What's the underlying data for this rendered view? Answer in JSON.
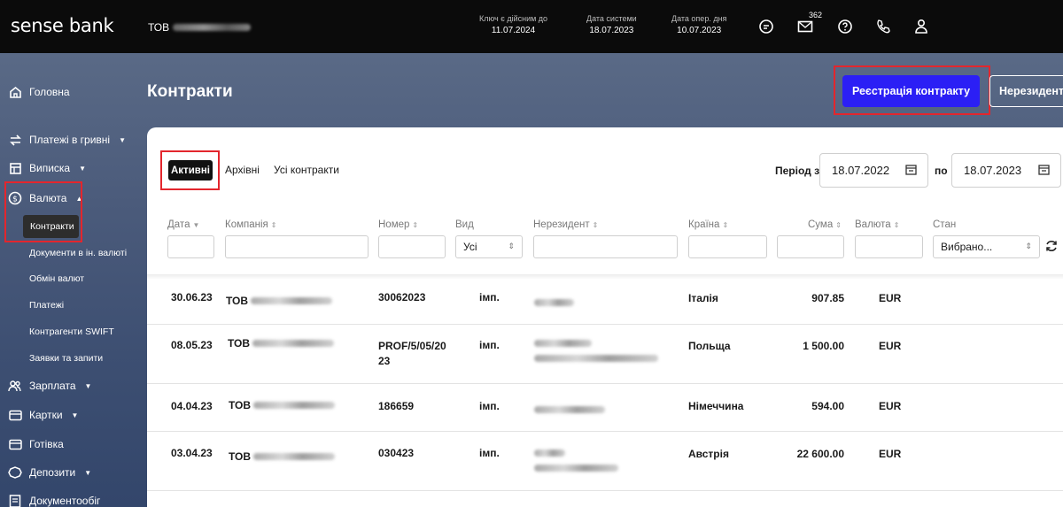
{
  "app": {
    "logo": "sense bank",
    "company_prefix": "ТОВ"
  },
  "topbar": {
    "key_label": "Ключ є дійсним до",
    "key_value": "11.07.2024",
    "sys_date_label": "Дата системи",
    "sys_date_value": "18.07.2023",
    "op_day_label": "Дата опер. дня",
    "op_day_value": "10.07.2023",
    "mail_count": "362",
    "icons": [
      "chat-icon",
      "mail-icon",
      "help-icon",
      "phone-icon",
      "user-icon"
    ]
  },
  "sidebar": {
    "items": [
      {
        "label": "Головна",
        "icon": "home-icon"
      },
      {
        "label": "Платежі в гривні",
        "icon": "transfer-icon",
        "caret": "▼"
      },
      {
        "label": "Виписка",
        "icon": "statement-icon",
        "caret": "▼"
      },
      {
        "label": "Валюта",
        "icon": "currency-icon",
        "caret": "▲"
      },
      {
        "label": "Зарплата",
        "icon": "people-icon",
        "caret": "▼"
      },
      {
        "label": "Картки",
        "icon": "card-icon",
        "caret": "▼"
      },
      {
        "label": "Готівка",
        "icon": "cash-icon"
      },
      {
        "label": "Депозити",
        "icon": "deposit-icon",
        "caret": "▼"
      },
      {
        "label": "Документообіг",
        "icon": "document-icon"
      }
    ],
    "currency_sub": [
      "Контракти",
      "Документи в ін. валюті",
      "Обмін валют",
      "Платежі",
      "Контрагенти SWIFT",
      "Заявки та запити"
    ]
  },
  "header": {
    "title": "Контракти",
    "register_button": "Реєстрація контракту",
    "nonresident_button": "Нерезиденти"
  },
  "tabs": [
    "Активні",
    "Архівні",
    "Усі контракти"
  ],
  "period": {
    "from_label": "Період з",
    "from_value": "18.07.2022",
    "to_label": "по",
    "to_value": "18.07.2023"
  },
  "columns": {
    "date": "Дата",
    "company": "Компанія",
    "number": "Номер",
    "type": "Вид",
    "nonresident": "Нерезидент",
    "country": "Країна",
    "amount": "Сума",
    "currency": "Валюта",
    "state": "Стан",
    "sort_desc": "▼",
    "sort_both": "⇕"
  },
  "filters": {
    "type_value": "Усі",
    "state_value": "Вибрано..."
  },
  "rows": [
    {
      "date": "30.06.23",
      "company": "ТОВ",
      "number": "30062023",
      "type": "імп.",
      "country": "Італія",
      "amount": "907.85",
      "currency": "EUR"
    },
    {
      "date": "08.05.23",
      "company": "ТОВ",
      "number": "PROF/5/05/2023",
      "type": "імп.",
      "country": "Польща",
      "amount": "1 500.00",
      "currency": "EUR"
    },
    {
      "date": "04.04.23",
      "company": "ТОВ",
      "number": "186659",
      "type": "імп.",
      "country": "Німеччина",
      "amount": "594.00",
      "currency": "EUR"
    },
    {
      "date": "03.04.23",
      "company": "ТОВ",
      "number": "030423",
      "type": "імп.",
      "country": "Австрія",
      "amount": "22 600.00",
      "currency": "EUR"
    }
  ],
  "colors": {
    "accent": "#2b1ff5",
    "highlight": "#e3262d",
    "topbar": "#0b0b0b"
  }
}
